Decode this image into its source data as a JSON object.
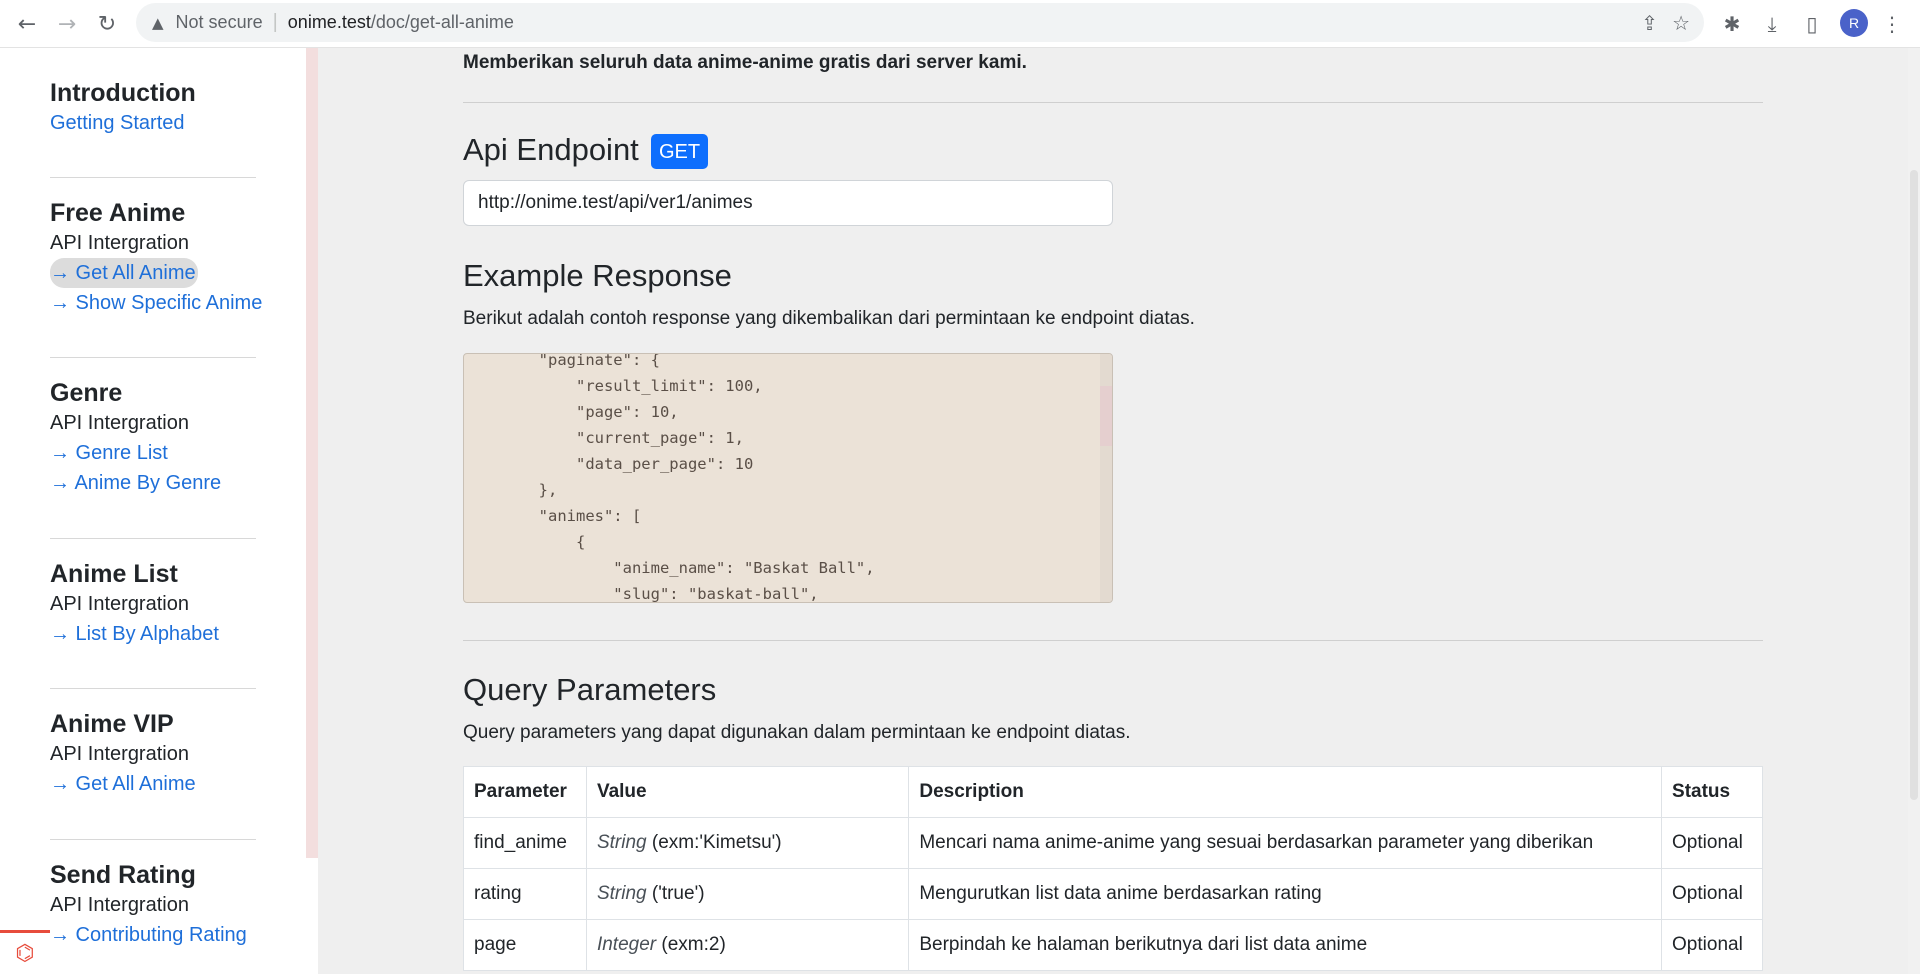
{
  "browser": {
    "security_text": "Not secure",
    "url_host": "onime.test",
    "url_path": "/doc/get-all-anime",
    "avatar_letter": "R",
    "icons": [
      "back-arrow-icon",
      "forward-arrow-icon",
      "reload-icon",
      "warning-icon",
      "share-icon",
      "star-icon",
      "puzzle-icon",
      "download-icon",
      "side-panel-icon",
      "more-vert-icon"
    ]
  },
  "sidebar": {
    "sections": [
      {
        "heading": "Introduction",
        "sub": "",
        "links": [
          "Getting Started"
        ]
      },
      {
        "heading": "Free Anime",
        "sub": "API Intergration",
        "links": [
          "→ Get All Anime",
          "→ Show Specific Anime"
        ]
      },
      {
        "heading": "Genre",
        "sub": "API Intergration",
        "links": [
          "→ Genre List",
          "→ Anime By Genre"
        ]
      },
      {
        "heading": "Anime List",
        "sub": "API Intergration",
        "links": [
          "→ List By Alphabet"
        ]
      },
      {
        "heading": "Anime VIP",
        "sub": "API Intergration",
        "links": [
          "→ Get All Anime"
        ]
      },
      {
        "heading": "Send Rating",
        "sub": "API Intergration",
        "links": [
          "→ Contributing Rating"
        ]
      }
    ],
    "active_link": "→ Get All Anime"
  },
  "main": {
    "lead": "Memberikan seluruh data anime-anime gratis dari server kami.",
    "endpoint_heading": "Api Endpoint",
    "method_badge": "GET",
    "endpoint_url": "http://onime.test/api/ver1/animes",
    "example_heading": "Example Response",
    "example_desc": "Berikut adalah contoh response yang dikembalikan dari permintaan ke endpoint diatas.",
    "code_lines": [
      "        \"paginate\": {",
      "            \"result_limit\": 100,",
      "            \"page\": 10,",
      "            \"current_page\": 1,",
      "            \"data_per_page\": 10",
      "        },",
      "        \"animes\": [",
      "            {",
      "                \"anime_name\": \"Baskat Ball\",",
      "                \"slug\": \"baskat-ball\","
    ],
    "query_heading": "Query Parameters",
    "query_desc": "Query parameters yang dapat digunakan dalam permintaan ke endpoint diatas.",
    "table": {
      "headers": [
        "Parameter",
        "Value",
        "Description",
        "Status"
      ],
      "rows": [
        {
          "param": "find_anime",
          "type": "String",
          "value": " (exm:'Kimetsu')",
          "desc": "Mencari nama anime-anime yang sesuai berdasarkan parameter yang diberikan",
          "status": "Optional"
        },
        {
          "param": "rating",
          "type": "String",
          "value": " ('true')",
          "desc": "Mengurutkan list data anime berdasarkan rating",
          "status": "Optional"
        },
        {
          "param": "page",
          "type": "Integer",
          "value": " (exm:2)",
          "desc": "Berpindah ke halaman berikutnya dari list data anime",
          "status": "Optional"
        }
      ]
    }
  }
}
